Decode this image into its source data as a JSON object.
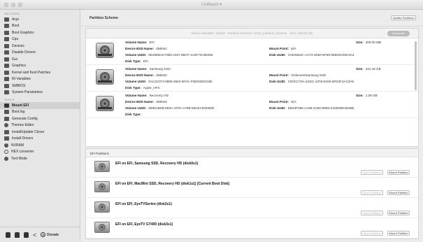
{
  "window": {
    "title": "UniBeast ▾"
  },
  "sidebar": {
    "sections": [
      {
        "title": "Sections",
        "items": [
          {
            "label": "Acpi",
            "icon": "grid-icon"
          },
          {
            "label": "Boot",
            "icon": "grid-icon"
          },
          {
            "label": "Boot Graphics",
            "icon": "grid-icon"
          },
          {
            "label": "Cpu",
            "icon": "grid-icon"
          },
          {
            "label": "Devices",
            "icon": "grid-icon"
          },
          {
            "label": "Disable Drivers",
            "icon": "grid-icon"
          },
          {
            "label": "Gui",
            "icon": "grid-icon"
          },
          {
            "label": "Graphics",
            "icon": "grid-icon"
          },
          {
            "label": "Kernel and Kext Patches",
            "icon": "grid-icon"
          },
          {
            "label": "Rt Variables",
            "icon": "grid-icon"
          },
          {
            "label": "SMBIOS",
            "icon": "grid-icon"
          },
          {
            "label": "System Parameters",
            "icon": "grid-icon"
          }
        ]
      },
      {
        "title": "Tools",
        "items": [
          {
            "label": "Mount EFI",
            "icon": "disk-icon",
            "selected": true
          },
          {
            "label": "Boot.log",
            "icon": "document-icon"
          },
          {
            "label": "Generate Config",
            "icon": "wand-icon"
          },
          {
            "label": "Themes Editor",
            "icon": "theme-icon"
          },
          {
            "label": "Install/Update Clover",
            "icon": "download-icon"
          },
          {
            "label": "Install Drivers",
            "icon": "download-icon"
          },
          {
            "label": "NVRAM",
            "icon": "chip-icon"
          },
          {
            "label": "HEX converter",
            "icon": "circle-icon"
          },
          {
            "label": "Text Mode",
            "icon": "text-icon"
          }
        ]
      }
    ],
    "footer": {
      "donate_label": "Donate"
    }
  },
  "main": {
    "title": "Partition Scheme",
    "update_button": "Update Partitions",
    "scheme_info": "Device Identifier: DISK0 · Partition Scheme: GUID_partition_scheme · Size: 250.05 GB",
    "scheme_badge": "Expanded",
    "volumes": [
      {
        "name": "EFI",
        "size": "209.00 MB",
        "bsd": "disk0s1",
        "mount": "N/A",
        "volume_uuid": "0E2986C6-F860-3107-89CF-1C9F70C68465",
        "disk_uuid": "C0D4952C-AA74-4D50-8F56-0E803C09C3A4",
        "type": "EFI"
      },
      {
        "name": "Samsung SSD",
        "size": "231.46 GB",
        "bsd": "disk0s2",
        "mount": "/Volumes/Samsung SSD",
        "volume_uuid": "0AC3C073-9858-3840-8FAC-F0EE5D0C08C",
        "disk_uuid": "CE0CC70A-4CEC-4378-9A00-6FD3F4AC3A9",
        "type": "Apple_HFS"
      },
      {
        "name": "Recovery HD",
        "size": "1.08 GB",
        "bsd": "disk0s3",
        "mount": "N/A",
        "volume_uuid": "669D1B2B-9D4A-370A-A75B-55CEAD2D60D",
        "disk_uuid": "DE54F086-AA58-4C80-89D3-418D00E4D4B5",
        "type": ""
      }
    ],
    "labels": {
      "volume_name": "Volume Name:",
      "size": "Size:",
      "bsd": "Device BSD Name:",
      "mount": "Mount Point:",
      "volume_uuid": "Volume UUID:",
      "disk_uuid": "Disk UUID:",
      "type": "Disk Type:"
    },
    "efi_header": "EFI Partitions",
    "efi_partitions": [
      {
        "name": "EFI on EFI, Samsung SSD, Recovery HD (disk0s1)"
      },
      {
        "name": "EFI on EFI, MacMini SSD, Recovery HD (disk1s1) [Current Boot Disk]"
      },
      {
        "name": "EFI on EFI, EyeTVSerien (disk2s1)"
      },
      {
        "name": "EFI on EFI, EyeTV GT400 (disk3s1)"
      }
    ],
    "open_label": "Open Partition",
    "mount_label": "Mount Partition"
  }
}
